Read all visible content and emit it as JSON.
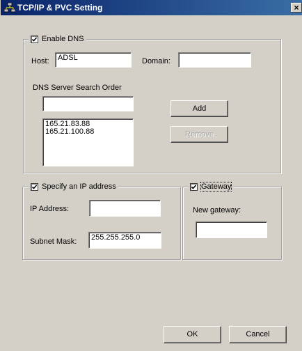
{
  "window": {
    "title": "TCP/IP & PVC Setting",
    "close_label": "×"
  },
  "dns": {
    "enable_label": "Enable DNS",
    "enabled": true,
    "host_label": "Host:",
    "host_value": "ADSL",
    "domain_label": "Domain:",
    "domain_value": "",
    "search_order_label": "DNS Server Search Order",
    "search_input_value": "",
    "add_label": "Add",
    "remove_label": "Remove",
    "servers": [
      "165.21.83.88",
      "165.21.100.88"
    ]
  },
  "ip": {
    "specify_label": "Specify an IP address",
    "enabled": true,
    "address_label": "IP Address:",
    "address_value": "",
    "mask_label": "Subnet Mask:",
    "mask_value": "255.255.255.0"
  },
  "gateway": {
    "label": "Gateway",
    "enabled": true,
    "new_label": "New gateway:",
    "new_value": ""
  },
  "buttons": {
    "ok_label": "OK",
    "cancel_label": "Cancel"
  },
  "colors": {
    "titlebar_start": "#0a246a",
    "titlebar_end": "#3a6ea5",
    "face": "#d4d0c8"
  }
}
